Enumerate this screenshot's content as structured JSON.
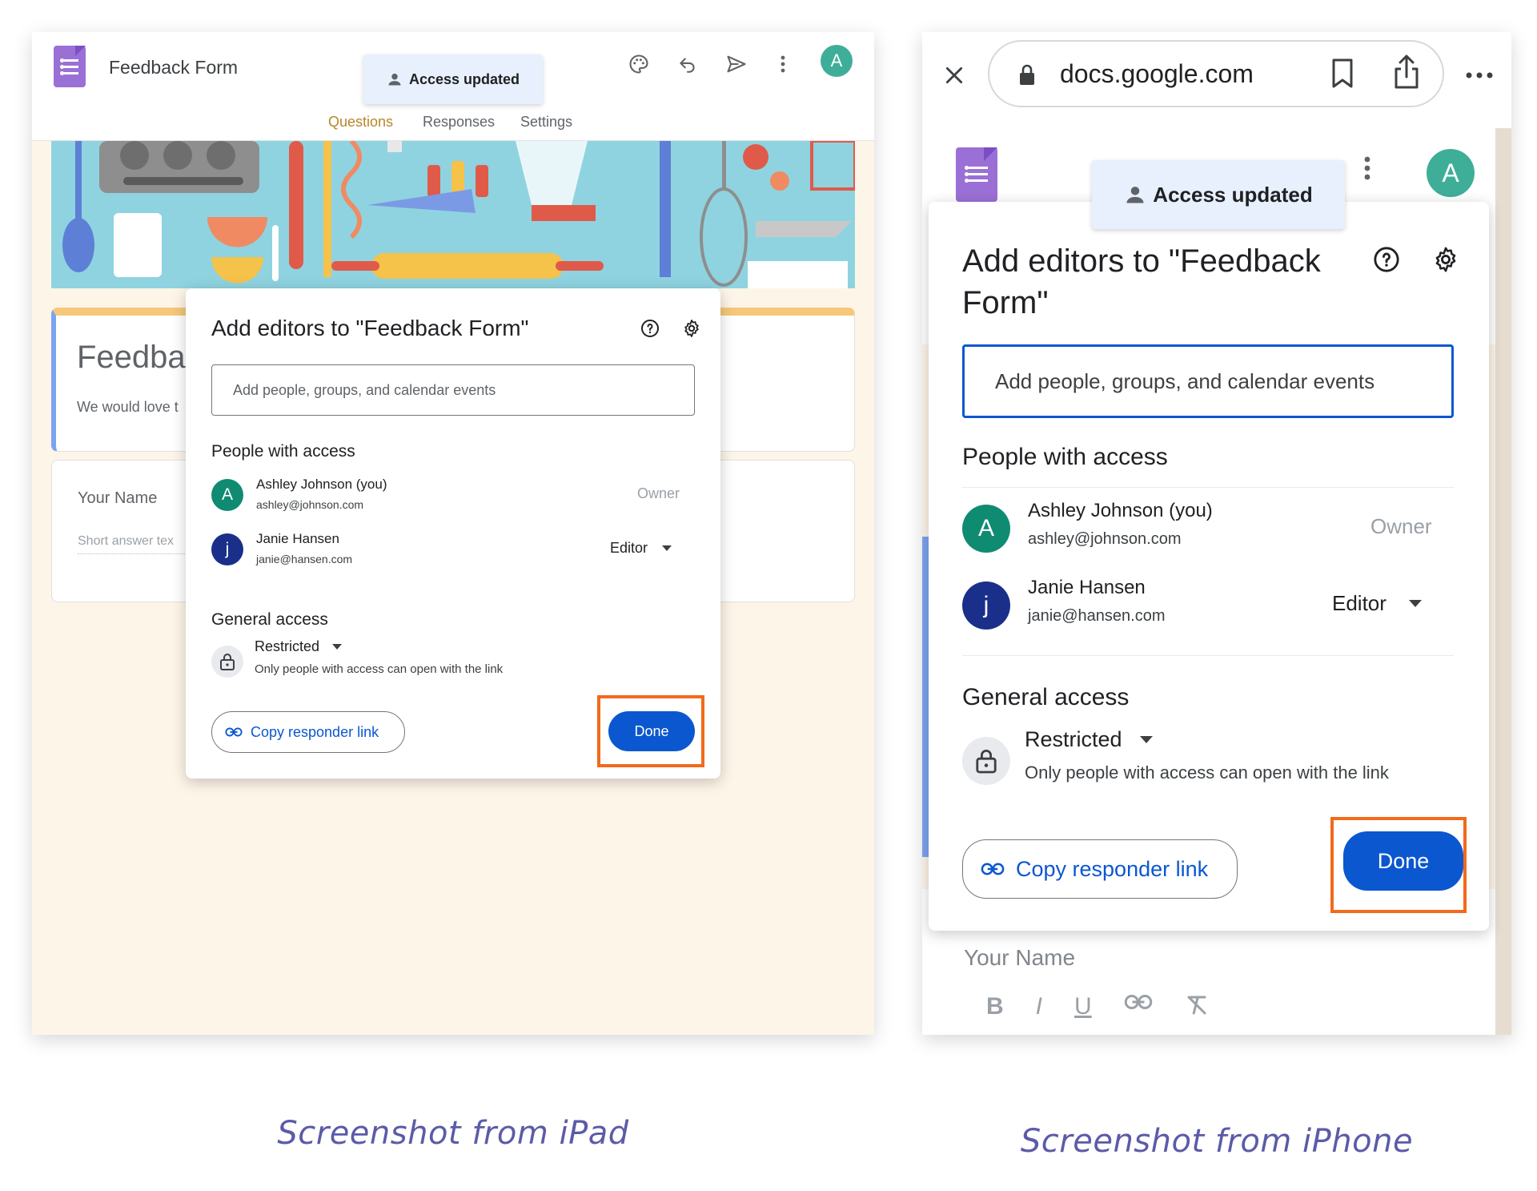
{
  "ipad": {
    "app_title": "Feedback Form",
    "toast": "Access updated",
    "tabs": [
      "Questions",
      "Responses",
      "Settings"
    ],
    "avatar_letter": "A",
    "form": {
      "title_partial": "Feedba",
      "desc_partial": "We would love t",
      "question_label": "Your Name",
      "question_placeholder_partial": "Short answer tex"
    },
    "dialog": {
      "title": "Add editors to \"Feedback Form\"",
      "input_placeholder": "Add people, groups, and calendar events",
      "people_heading": "People with access",
      "people": [
        {
          "initial": "A",
          "name": "Ashley Johnson (you)",
          "email": "ashley@johnson.com",
          "role": "Owner",
          "avatar_color": "#0f8b72"
        },
        {
          "initial": "j",
          "name": "Janie Hansen",
          "email": "janie@hansen.com",
          "role": "Editor",
          "avatar_color": "#1a2f8a"
        }
      ],
      "general_heading": "General access",
      "access_level": "Restricted",
      "access_desc": "Only people with access can open with the link",
      "copy_link": "Copy responder link",
      "done": "Done"
    }
  },
  "iphone": {
    "url": "docs.google.com",
    "toast": "Access updated",
    "avatar_letter": "A",
    "dialog": {
      "title": "Add editors to \"Feedback Form\"",
      "input_placeholder": "Add people, groups, and calendar events",
      "people_heading": "People with access",
      "people": [
        {
          "initial": "A",
          "name": "Ashley Johnson (you)",
          "email": "ashley@johnson.com",
          "role": "Owner",
          "avatar_color": "#0f8b72"
        },
        {
          "initial": "j",
          "name": "Janie Hansen",
          "email": "janie@hansen.com",
          "role": "Editor",
          "avatar_color": "#1a2f8a"
        }
      ],
      "general_heading": "General access",
      "access_level": "Restricted",
      "access_desc": "Only people with access can open with the link",
      "copy_link": "Copy responder link",
      "done": "Done"
    },
    "below_question": "Your Name"
  },
  "captions": {
    "ipad": "Screenshot from iPad",
    "iphone": "Screenshot from iPhone"
  },
  "colors": {
    "accent_blue": "#0b57d0",
    "highlight_orange": "#f26a1b",
    "toast_bg": "#e8f0fe",
    "tab_active": "#b8862a",
    "avatar_header": "#3fae99"
  }
}
